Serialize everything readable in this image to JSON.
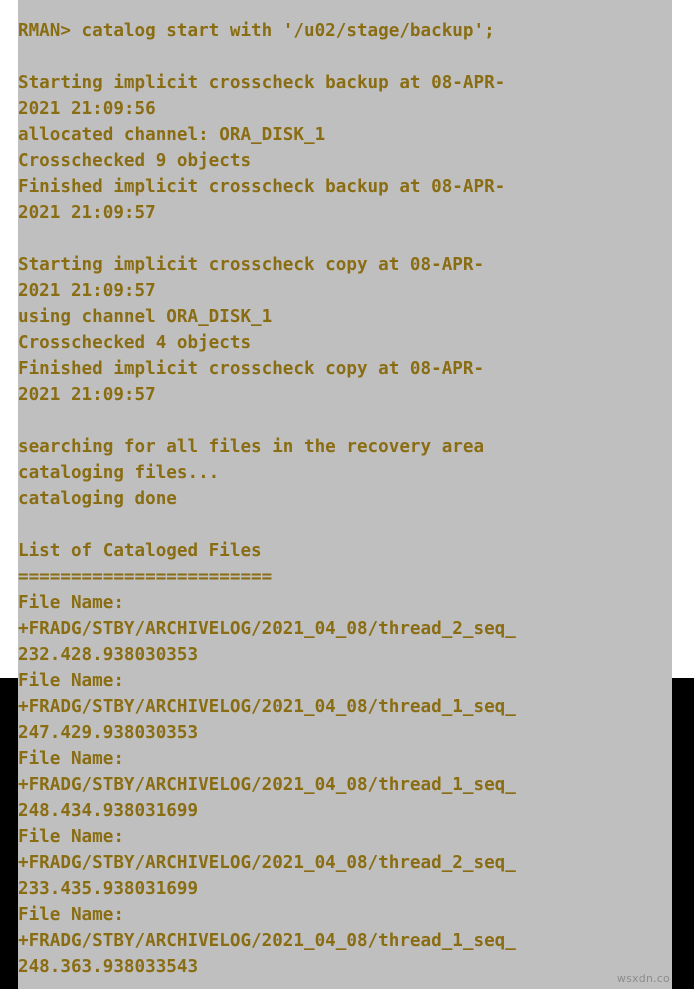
{
  "window": {
    "kind": "terminal-console",
    "background_color": "#bfbfbf",
    "text_color": "#8a6d13",
    "letterbox_color": "#000000"
  },
  "console": {
    "prompt": "RMAN>",
    "command": "catalog start with '/u02/stage/backup';",
    "lines": [
      "RMAN> catalog start with '/u02/stage/backup';",
      "",
      "Starting implicit crosscheck backup at 08-APR-",
      "2021 21:09:56",
      "allocated channel: ORA_DISK_1",
      "Crosschecked 9 objects",
      "Finished implicit crosscheck backup at 08-APR-",
      "2021 21:09:57",
      "",
      "Starting implicit crosscheck copy at 08-APR-",
      "2021 21:09:57",
      "using channel ORA_DISK_1",
      "Crosschecked 4 objects",
      "Finished implicit crosscheck copy at 08-APR-",
      "2021 21:09:57",
      "",
      "searching for all files in the recovery area",
      "cataloging files...",
      "cataloging done",
      "",
      "List of Cataloged Files",
      "========================",
      "File Name:",
      "+FRADG/STBY/ARCHIVELOG/2021_04_08/thread_2_seq_",
      "232.428.938030353",
      "File Name:",
      "+FRADG/STBY/ARCHIVELOG/2021_04_08/thread_1_seq_",
      "247.429.938030353",
      "File Name:",
      "+FRADG/STBY/ARCHIVELOG/2021_04_08/thread_1_seq_",
      "248.434.938031699",
      "File Name:",
      "+FRADG/STBY/ARCHIVELOG/2021_04_08/thread_2_seq_",
      "233.435.938031699",
      "File Name:",
      "+FRADG/STBY/ARCHIVELOG/2021_04_08/thread_1_seq_",
      "248.363.938033543"
    ],
    "sections": {
      "crosscheck_backup": {
        "start_label": "Starting implicit crosscheck backup at 08-APR-2021 21:09:56",
        "channel_label": "allocated channel: ORA_DISK_1",
        "channel_name": "ORA_DISK_1",
        "crosschecked_label": "Crosschecked 9 objects",
        "crosschecked_count": 9,
        "finish_label": "Finished implicit crosscheck backup at 08-APR-2021 21:09:57",
        "start_time": "08-APR-2021 21:09:56",
        "finish_time": "08-APR-2021 21:09:57"
      },
      "crosscheck_copy": {
        "start_label": "Starting implicit crosscheck copy at 08-APR-2021 21:09:57",
        "channel_label": "using channel ORA_DISK_1",
        "channel_name": "ORA_DISK_1",
        "crosschecked_label": "Crosschecked 4 objects",
        "crosschecked_count": 4,
        "finish_label": "Finished implicit crosscheck copy at 08-APR-2021 21:09:57",
        "start_time": "08-APR-2021 21:09:57",
        "finish_time": "08-APR-2021 21:09:57"
      },
      "recovery_area": {
        "searching_label": "searching for all files in the recovery area",
        "cataloging_label": "cataloging files...",
        "done_label": "cataloging done"
      },
      "catalog_listing": {
        "heading": "List of Cataloged Files",
        "separator": "========================",
        "file_name_label": "File Name:",
        "files": [
          "+FRADG/STBY/ARCHIVELOG/2021_04_08/thread_2_seq_232.428.938030353",
          "+FRADG/STBY/ARCHIVELOG/2021_04_08/thread_1_seq_247.429.938030353",
          "+FRADG/STBY/ARCHIVELOG/2021_04_08/thread_1_seq_248.434.938031699",
          "+FRADG/STBY/ARCHIVELOG/2021_04_08/thread_2_seq_233.435.938031699",
          "+FRADG/STBY/ARCHIVELOG/2021_04_08/thread_1_seq_248.363.938033543"
        ]
      }
    }
  },
  "watermark": {
    "text": "wsxdn.co"
  }
}
